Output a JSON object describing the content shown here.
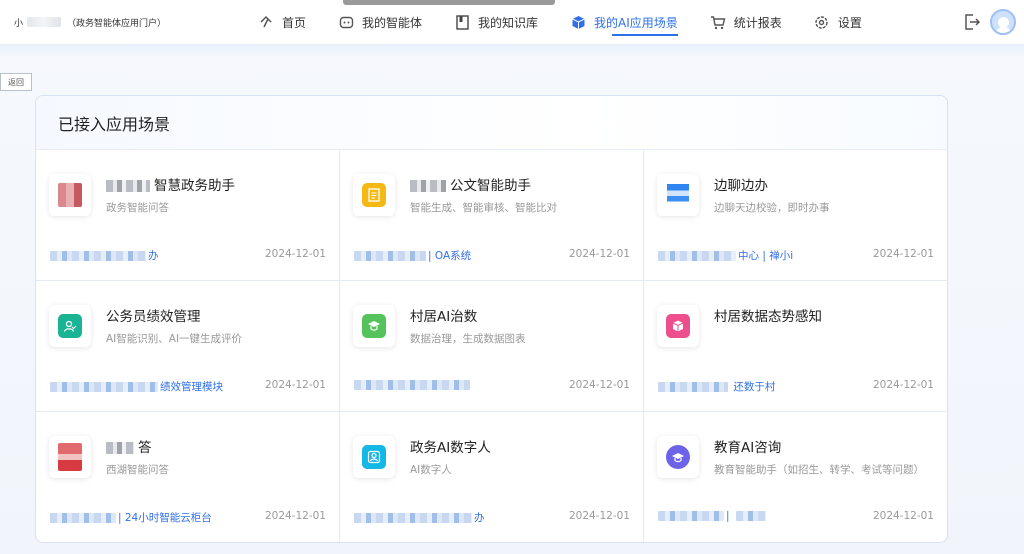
{
  "header": {
    "brand_prefix": "小",
    "brand_suffix": "（政务智能体应用门户）",
    "nav": [
      {
        "label": "首页",
        "icon": "home-icon"
      },
      {
        "label": "我的智能体",
        "icon": "bot-icon"
      },
      {
        "label": "我的知识库",
        "icon": "book-icon"
      },
      {
        "label": "我的AI应用场景",
        "icon": "cube-icon",
        "active": true
      },
      {
        "label": "统计报表",
        "icon": "cart-chart-icon"
      },
      {
        "label": "设置",
        "icon": "gear-icon"
      }
    ]
  },
  "back_label": "返回",
  "panel": {
    "title": "已接入应用场景",
    "cards": [
      {
        "title": "智慧政务助手",
        "desc": "政务智能问答",
        "tag": "办",
        "date": "2024-12-01",
        "icon_color": "#d9898d"
      },
      {
        "title": "公文智能助手",
        "desc": "智能生成、智能审核、智能比对",
        "tag": "| OA系统",
        "date": "2024-12-01",
        "icon_color": "#f5b915"
      },
      {
        "title": "边聊边办",
        "desc": "边聊天边校验，即时办事",
        "tag": "中心 | 禅小i",
        "date": "2024-12-01",
        "icon_color": "#2f86f0"
      },
      {
        "title": "公务员绩效管理",
        "desc": "AI智能识别、AI一键生成评价",
        "tag": "绩效管理模块",
        "date": "2024-12-01",
        "icon_color": "#1ab394"
      },
      {
        "title": "村居AI治数",
        "desc": "数据治理，生成数据图表",
        "tag": "",
        "date": "2024-12-01",
        "icon_color": "#56c25b"
      },
      {
        "title": "村居数据态势感知",
        "desc": "",
        "tag": "还数于村",
        "date": "2024-12-01",
        "icon_color": "#ec4f8c"
      },
      {
        "title": "答",
        "desc": "西湖智能问答",
        "tag": "| 24小时智能云柜台",
        "date": "2024-12-01",
        "icon_color": "#e06a6e"
      },
      {
        "title": "政务AI数字人",
        "desc": "AI数字人",
        "tag": "办",
        "date": "2024-12-01",
        "icon_color": "#14b8e6"
      },
      {
        "title": "教育AI咨询",
        "desc": "教育智能助手（如招生、转学、考试等问题）",
        "tag": "|",
        "date": "2024-12-01",
        "icon_color": "#6c63e8"
      }
    ]
  }
}
